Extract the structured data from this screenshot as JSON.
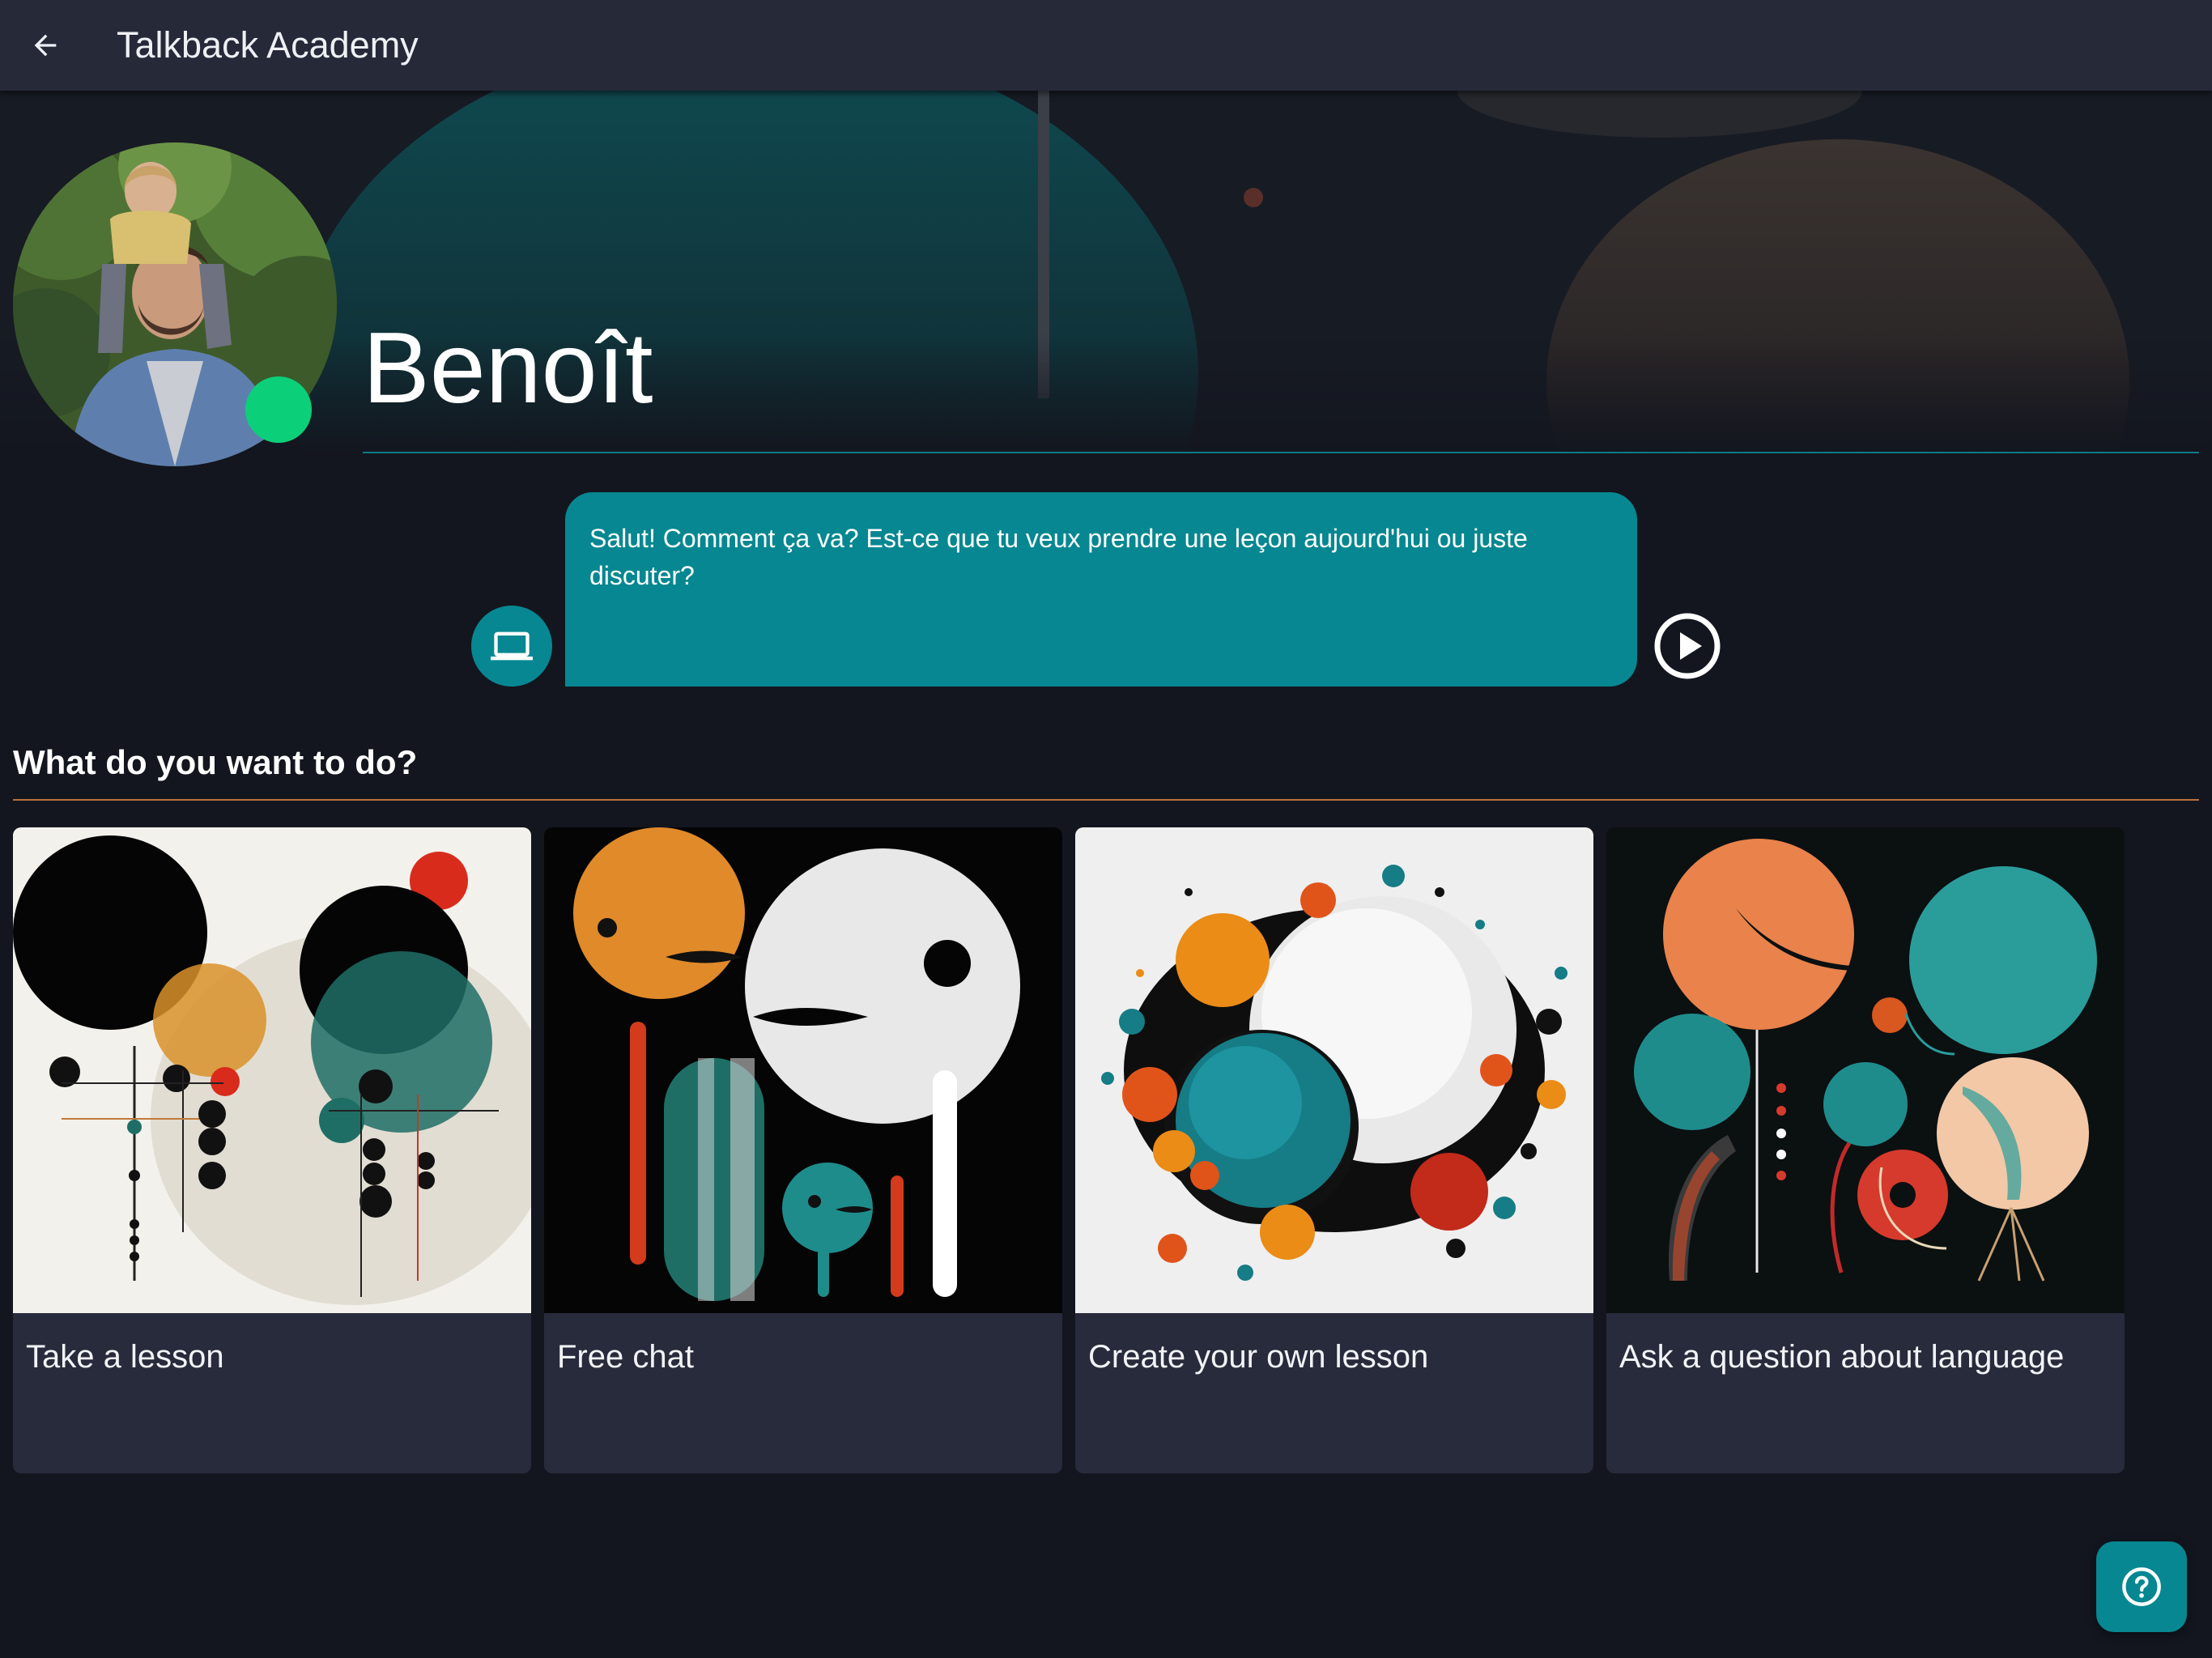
{
  "app_bar": {
    "title": "Talkback Academy",
    "back_icon": "arrow-left-icon"
  },
  "profile": {
    "name": "Benoît",
    "status": "online",
    "status_color": "#0ccf7a"
  },
  "message": {
    "text": "Salut! Comment ça va? Est-ce que tu veux prendre une leçon aujourd'hui ou juste discuter?",
    "sender_icon": "laptop-icon",
    "play_icon": "play-circle-icon",
    "bubble_color": "#078791"
  },
  "activities": {
    "heading": "What do you want to do?",
    "cards": [
      {
        "label": "Take a lesson"
      },
      {
        "label": "Free chat"
      },
      {
        "label": "Create your own lesson"
      },
      {
        "label": "Ask a question about language"
      }
    ]
  },
  "help": {
    "icon": "help-circle-icon"
  },
  "colors": {
    "background": "#13161f",
    "app_bar": "#252938",
    "accent_teal": "#078791",
    "accent_orange": "#b9713c",
    "card": "#272b3b"
  }
}
